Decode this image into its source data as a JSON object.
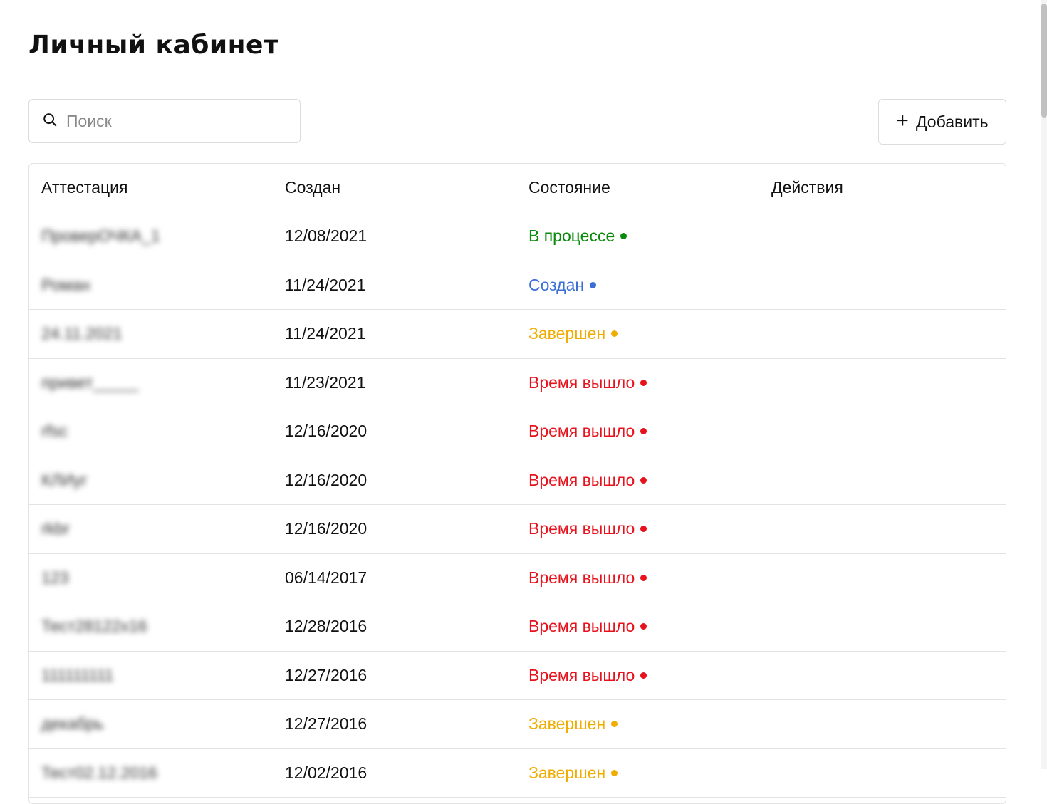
{
  "page": {
    "title": "Личный кабинет"
  },
  "toolbar": {
    "search_placeholder": "Поиск",
    "search_icon": "search-icon",
    "add_label": "Добавить",
    "add_icon": "plus-icon"
  },
  "table": {
    "columns": [
      "Аттестация",
      "Создан",
      "Состояние",
      "Действия"
    ],
    "rows": [
      {
        "name": "ПроверОЧКА_1",
        "created": "12/08/2021",
        "status": "В процессе",
        "color": "#0a8a0a"
      },
      {
        "name": "Роман",
        "created": "11/24/2021",
        "status": "Создан",
        "color": "#3b6fd6"
      },
      {
        "name": "24.11.2021",
        "created": "11/24/2021",
        "status": "Завершен",
        "color": "#f0ad00"
      },
      {
        "name": "привет_____",
        "created": "11/23/2021",
        "status": "Время вышло",
        "color": "#e8121c"
      },
      {
        "name": "rfsc",
        "created": "12/16/2020",
        "status": "Время вышло",
        "color": "#e8121c"
      },
      {
        "name": "КЛИуг",
        "created": "12/16/2020",
        "status": "Время вышло",
        "color": "#e8121c"
      },
      {
        "name": "rkbr",
        "created": "12/16/2020",
        "status": "Время вышло",
        "color": "#e8121c"
      },
      {
        "name": "123",
        "created": "06/14/2017",
        "status": "Время вышло",
        "color": "#e8121c"
      },
      {
        "name": "Тест28122х16",
        "created": "12/28/2016",
        "status": "Время вышло",
        "color": "#e8121c"
      },
      {
        "name": "111111111",
        "created": "12/27/2016",
        "status": "Время вышло",
        "color": "#e8121c"
      },
      {
        "name": "декабрь",
        "created": "12/27/2016",
        "status": "Завершен",
        "color": "#f0ad00"
      },
      {
        "name": "Тест02.12.2016",
        "created": "12/02/2016",
        "status": "Завершен",
        "color": "#f0ad00"
      }
    ]
  }
}
